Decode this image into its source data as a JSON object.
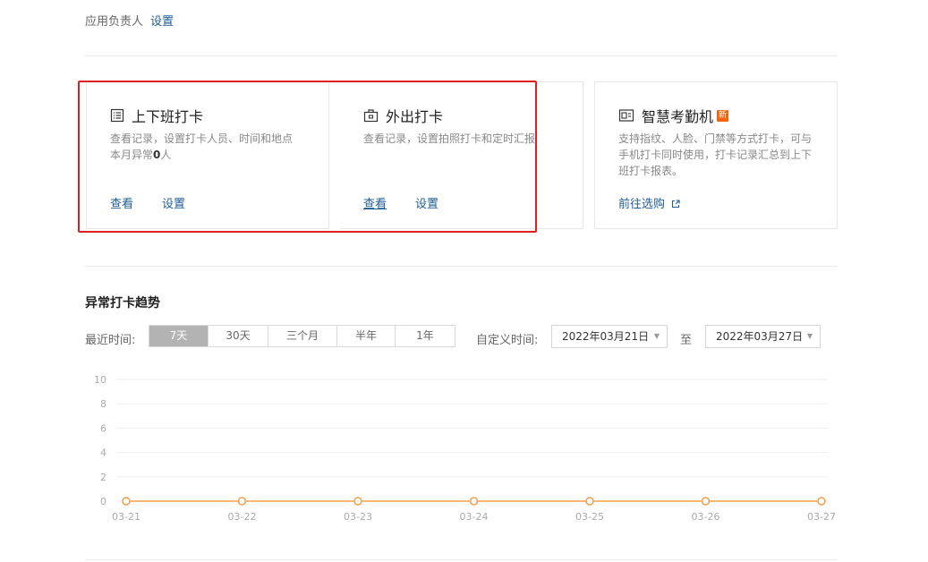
{
  "header": {
    "owner_label": "应用负责人",
    "settings_link": "设置"
  },
  "cards": [
    {
      "icon": "list-icon",
      "title": "上下班打卡",
      "desc_line1": "查看记录，设置打卡人员、时间和地点",
      "desc_prefix": "本月异常",
      "desc_count": "0",
      "desc_suffix": "人",
      "links": [
        "查看",
        "设置"
      ]
    },
    {
      "icon": "briefcase-icon",
      "title": "外出打卡",
      "desc_line1": "查看记录，设置拍照打卡和定时汇报",
      "links": [
        "查看",
        "设置"
      ]
    },
    {
      "icon": "attendance-machine-icon",
      "title": "智慧考勤机",
      "badge": "新",
      "desc_lines": [
        "支持指纹、人脸、门禁等方式打卡，可与",
        "手机打卡同时使用，打卡记录汇总到上下",
        "班打卡报表。"
      ],
      "link": "前往选购"
    }
  ],
  "trend": {
    "title": "异常打卡趋势",
    "recent_label": "最近时间:",
    "ranges": [
      "7天",
      "30天",
      "三个月",
      "半年",
      "1年"
    ],
    "active_range": "7天",
    "custom_label": "自定义时间:",
    "start_date": "2022年03月21日",
    "to_label": "至",
    "end_date": "2022年03月27日"
  },
  "chart_data": {
    "type": "line",
    "categories": [
      "03-21",
      "03-22",
      "03-23",
      "03-24",
      "03-25",
      "03-26",
      "03-27"
    ],
    "series": [
      {
        "values": [
          0,
          0,
          0,
          0,
          0,
          0,
          0
        ]
      }
    ],
    "ylim": [
      0,
      10
    ],
    "yticks": [
      0,
      2,
      4,
      6,
      8,
      10
    ],
    "grid": true,
    "color": "#f0a04b"
  }
}
